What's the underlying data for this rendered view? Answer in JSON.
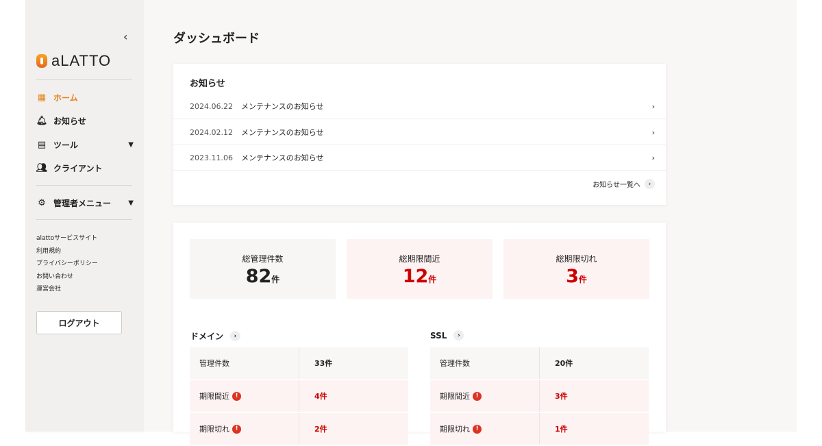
{
  "sidebar": {
    "logo": "aLATTO",
    "nav": [
      {
        "label": "ホーム",
        "icon": "dashboard-icon",
        "active": true
      },
      {
        "label": "お知らせ",
        "icon": "bell-icon"
      },
      {
        "label": "ツール",
        "icon": "toolbox-icon"
      },
      {
        "label": "クライアント",
        "icon": "users-icon"
      }
    ],
    "admin": "管理者メニュー",
    "links": [
      "alattoサービスサイト",
      "利用規約",
      "プライバシーポリシー",
      "お問い合わせ",
      "運営会社"
    ],
    "logout": "ログアウト"
  },
  "page_title": "ダッシュボード",
  "news": {
    "title": "お知らせ",
    "items": [
      {
        "date": "2024.06.22",
        "title": "メンテナンスのお知らせ"
      },
      {
        "date": "2024.02.12",
        "title": "メンテナンスのお知らせ"
      },
      {
        "date": "2023.11.06",
        "title": "メンテナンスのお知らせ"
      }
    ],
    "more": "お知らせ一覧へ"
  },
  "stats": [
    {
      "label": "総管理件数",
      "value": "82",
      "unit": "件"
    },
    {
      "label": "総期限間近",
      "value": "12",
      "unit": "件"
    },
    {
      "label": "総期限切れ",
      "value": "3",
      "unit": "件"
    }
  ],
  "domain": {
    "title": "ドメイン",
    "rows": [
      {
        "k": "管理件数",
        "v": "33件"
      },
      {
        "k": "期限間近",
        "v": "4件"
      },
      {
        "k": "期限切れ",
        "v": "2件"
      }
    ]
  },
  "ssl": {
    "title": "SSL",
    "rows": [
      {
        "k": "管理件数",
        "v": "20件"
      },
      {
        "k": "期限間近",
        "v": "3件"
      },
      {
        "k": "期限切れ",
        "v": "1件"
      }
    ]
  },
  "colors": {
    "accent": "#e8821c",
    "danger": "#c00000"
  }
}
